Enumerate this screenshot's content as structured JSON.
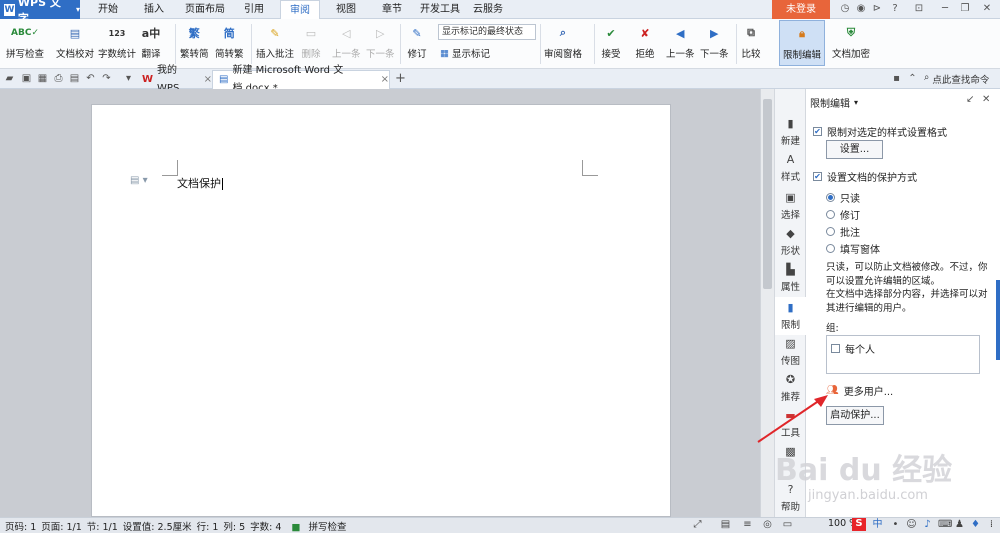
{
  "app": {
    "name": "WPS 文字"
  },
  "menu": {
    "tabs": [
      "开始",
      "插入",
      "页面布局",
      "引用",
      "审阅",
      "视图",
      "章节",
      "开发工具",
      "云服务"
    ],
    "active_tab": "审阅",
    "login_label": "未登录"
  },
  "ribbon": {
    "spell_check": "拼写检查",
    "doc_proof": "文档校对",
    "word_count": "字数统计",
    "translate": "翻译",
    "trad_to_simp": "繁转简",
    "simp_to_trad": "简转繁",
    "insert_comment": "插入批注",
    "delete": "删除",
    "prev": "上一条",
    "next": "下一条",
    "revision": "修订",
    "markup_select": "显示标记的最终状态",
    "show_markup": "显示标记",
    "review_pane": "审阅窗格",
    "accept": "接受",
    "reject": "拒绝",
    "prev2": "上一条",
    "next2": "下一条",
    "compare": "比较",
    "restrict_edit": "限制编辑",
    "doc_encrypt": "文档加密"
  },
  "tabs_bar": {
    "tabs": [
      {
        "label": "我的WPS"
      },
      {
        "label": "新建 Microsoft Word 文档.docx *"
      }
    ],
    "search_command": "点此查找命令"
  },
  "document": {
    "text": "文档保护"
  },
  "side_tools": [
    "新建",
    "样式",
    "选择",
    "形状",
    "属性",
    "限制",
    "传图",
    "推荐",
    "工具",
    "",
    "帮助"
  ],
  "pane": {
    "title": "限制编辑",
    "format_restrict": "限制对选定的样式设置格式",
    "settings_button": "设置...",
    "protect_mode": "设置文档的保护方式",
    "options": [
      "只读",
      "修订",
      "批注",
      "填写窗体"
    ],
    "selected_option": "只读",
    "description_1": "只读，可以防止文档被修改。不过，你可以设置允许编辑的区域。",
    "description_2": "在文档中选择部分内容，并选择可以对其进行编辑的用户。",
    "groups_label": "组:",
    "everyone": "每个人",
    "more_users": "更多用户...",
    "start_protect": "启动保护..."
  },
  "status": {
    "page_num": "页码: 1",
    "pages": "页面: 1/1",
    "section": "节: 1/1",
    "setting_value": "设置值: 2.5厘米",
    "row": "行: 1",
    "col": "列: 5",
    "word_count": "字数: 4",
    "spell_check": "拼写检查",
    "zoom": "100 %"
  },
  "watermark": {
    "main": "Bai du 经验",
    "sub": "jingyan.baidu.com"
  },
  "colors": {
    "accent": "#2f6ec5",
    "login": "#e8653a",
    "arrow": "#e0262a"
  }
}
